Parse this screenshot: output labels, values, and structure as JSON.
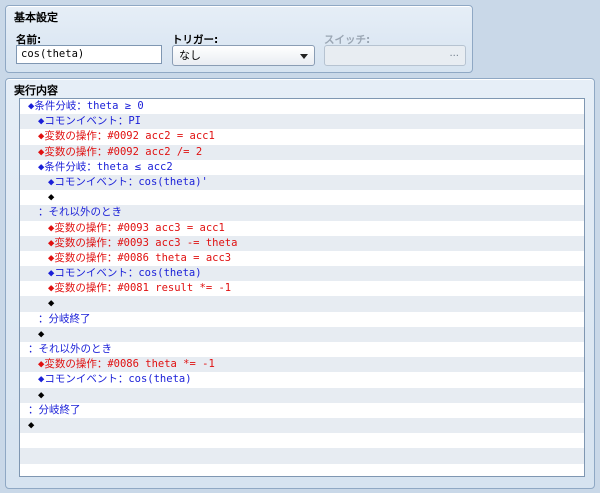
{
  "basic": {
    "title": "基本設定",
    "name_label": "名前:",
    "name_value": "cos(theta)",
    "trigger_label": "トリガー:",
    "trigger_value": "なし",
    "switch_label": "スイッチ:",
    "switch_button": "..."
  },
  "exec": {
    "title": "実行内容",
    "rows": [
      {
        "text": "◆条件分岐：theta ≥ 0",
        "indent": 0,
        "color": "blue"
      },
      {
        "text": "◆コモンイベント：PI",
        "indent": 1,
        "color": "blue"
      },
      {
        "text": "◆変数の操作：#0092 acc2 = acc1",
        "indent": 1,
        "color": "red"
      },
      {
        "text": "◆変数の操作：#0092 acc2 /= 2",
        "indent": 1,
        "color": "red"
      },
      {
        "text": "◆条件分岐：theta ≤ acc2",
        "indent": 1,
        "color": "blue"
      },
      {
        "text": "◆コモンイベント：cos(theta)'",
        "indent": 2,
        "color": "blue"
      },
      {
        "text": "◆",
        "indent": 2,
        "color": "black"
      },
      {
        "text": "：それ以外のとき",
        "indent": 1,
        "color": "blue"
      },
      {
        "text": "◆変数の操作：#0093 acc3 = acc1",
        "indent": 2,
        "color": "red"
      },
      {
        "text": "◆変数の操作：#0093 acc3 -= theta",
        "indent": 2,
        "color": "red"
      },
      {
        "text": "◆変数の操作：#0086 theta = acc3",
        "indent": 2,
        "color": "red"
      },
      {
        "text": "◆コモンイベント：cos(theta)",
        "indent": 2,
        "color": "blue"
      },
      {
        "text": "◆変数の操作：#0081 result *= -1",
        "indent": 2,
        "color": "red"
      },
      {
        "text": "◆",
        "indent": 2,
        "color": "black"
      },
      {
        "text": "：分岐終了",
        "indent": 1,
        "color": "blue"
      },
      {
        "text": "◆",
        "indent": 1,
        "color": "black"
      },
      {
        "text": "：それ以外のとき",
        "indent": 0,
        "color": "blue"
      },
      {
        "text": "◆変数の操作：#0086 theta *= -1",
        "indent": 1,
        "color": "red"
      },
      {
        "text": "◆コモンイベント：cos(theta)",
        "indent": 1,
        "color": "blue"
      },
      {
        "text": "◆",
        "indent": 1,
        "color": "black"
      },
      {
        "text": "：分岐終了",
        "indent": 0,
        "color": "blue"
      },
      {
        "text": "◆",
        "indent": 0,
        "color": "black"
      },
      {
        "text": "",
        "indent": 0,
        "color": "black"
      },
      {
        "text": "",
        "indent": 0,
        "color": "black"
      },
      {
        "text": "",
        "indent": 0,
        "color": "black"
      }
    ]
  }
}
